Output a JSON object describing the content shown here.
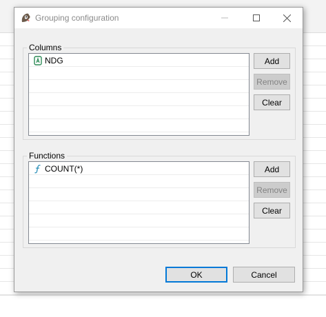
{
  "dialog": {
    "title": "Grouping configuration"
  },
  "columns_group": {
    "legend": "Columns",
    "items": [
      {
        "label": "NDG",
        "icon": "attribute-icon"
      }
    ],
    "buttons": {
      "add": "Add",
      "remove": "Remove",
      "clear": "Clear"
    }
  },
  "functions_group": {
    "legend": "Functions",
    "items": [
      {
        "label": "COUNT(*)",
        "icon": "function-icon"
      }
    ],
    "buttons": {
      "add": "Add",
      "remove": "Remove",
      "clear": "Clear"
    }
  },
  "footer": {
    "ok": "OK",
    "cancel": "Cancel"
  },
  "colors": {
    "attribute_icon": "#2e8b57",
    "function_icon": "#2a8fb8",
    "default_button_border": "#0078d7"
  }
}
